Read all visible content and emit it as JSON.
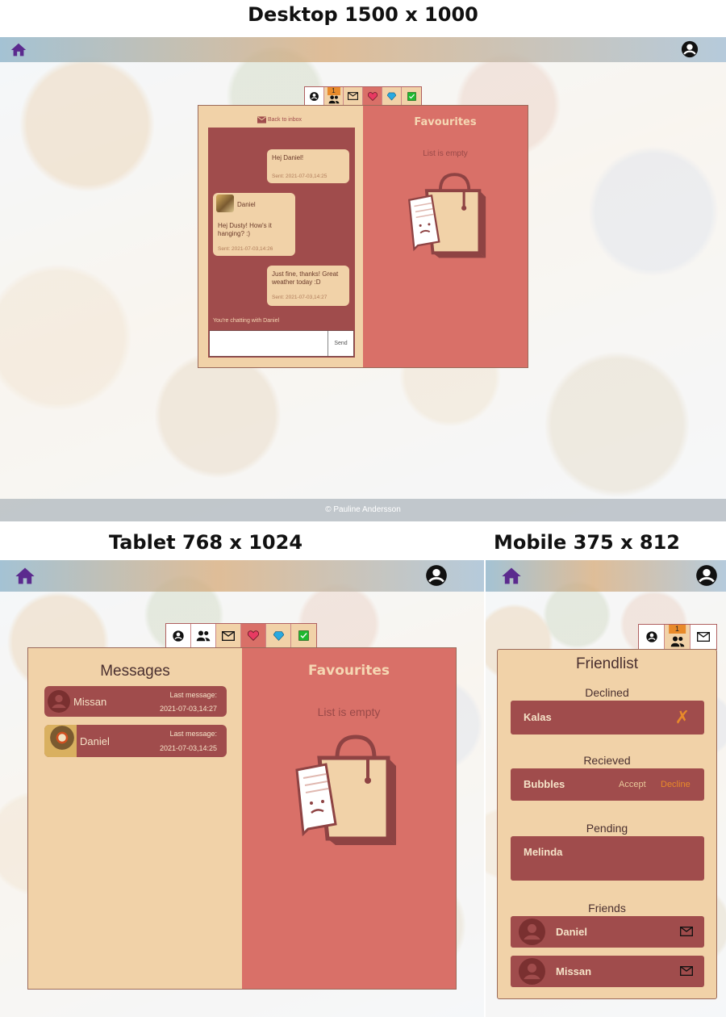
{
  "captions": {
    "desktop": "Desktop 1500 x 1000",
    "tablet": "Tablet 768 x 1024",
    "mobile": "Mobile 375 x 812"
  },
  "colors": {
    "accent_purple": "#5b2a8e",
    "pane_cream": "#f1d2a8",
    "pane_red": "#d97068",
    "row_red": "#a04c4c",
    "badge_orange": "#e88a2a",
    "decline_orange": "#e88a2a"
  },
  "icons": [
    "home-icon",
    "profile-icon",
    "account-circle-icon",
    "people-icon",
    "mail-icon",
    "heart-icon",
    "diamond-icon",
    "checkbox-icon",
    "shopping-bag-icon",
    "avatar-placeholder-icon"
  ],
  "friend_badge": "1",
  "desktop": {
    "back_to_inbox": "Back to inbox",
    "messages": [
      {
        "text": "Hej Daniel!",
        "sent": "Sent: 2021-07-03,14:25",
        "side": "right"
      },
      {
        "author": "Daniel",
        "text": "Hej Dusty! How's it hanging? :)",
        "sent": "Sent: 2021-07-03,14:26",
        "side": "left"
      },
      {
        "text": "Just fine, thanks! Great weather today :D",
        "sent": "Sent: 2021-07-03,14:27",
        "side": "right"
      }
    ],
    "chat_status": "You're chatting with Daniel",
    "send_label": "Send",
    "favourites_title": "Favourites",
    "empty_text": "List is empty",
    "footer": "© Pauline Andersson"
  },
  "tablet": {
    "messages_title": "Messages",
    "threads": [
      {
        "name": "Missan",
        "last_label": "Last message:",
        "last_time": "2021-07-03,14:27"
      },
      {
        "name": "Daniel",
        "last_label": "Last message:",
        "last_time": "2021-07-03,14:25"
      }
    ],
    "favourites_title": "Favourites",
    "empty_text": "List is empty"
  },
  "mobile": {
    "friendlist_title": "Friendlist",
    "declined_title": "Declined",
    "declined": [
      {
        "name": "Kalas",
        "mark": "✗"
      }
    ],
    "received_title": "Recieved",
    "received": [
      {
        "name": "Bubbles",
        "accept": "Accept",
        "decline": "Decline"
      }
    ],
    "pending_title": "Pending",
    "pending": [
      {
        "name": "Melinda"
      }
    ],
    "friends_title": "Friends",
    "friends": [
      {
        "name": "Daniel"
      },
      {
        "name": "Missan"
      }
    ]
  }
}
